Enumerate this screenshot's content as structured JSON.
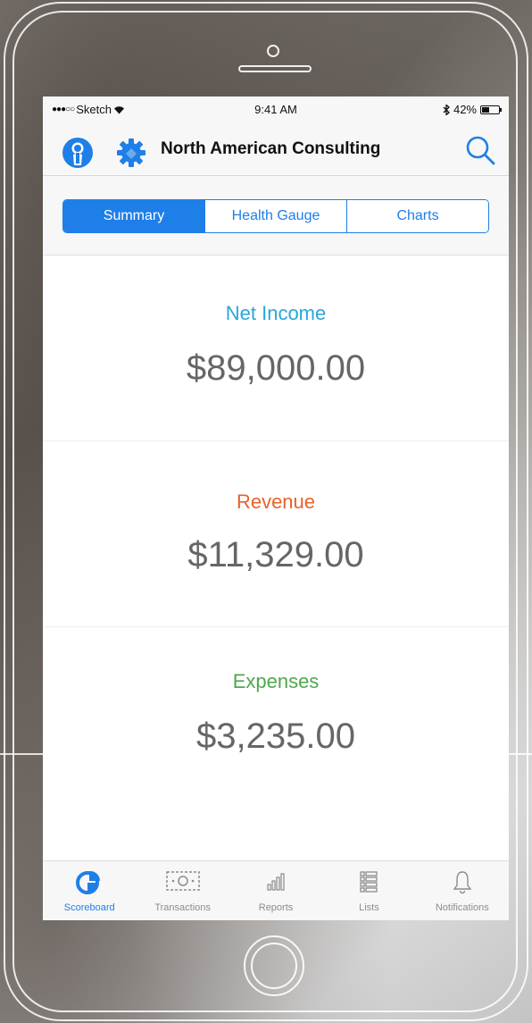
{
  "status_bar": {
    "carrier": "Sketch",
    "time": "9:41 AM",
    "battery": "42%"
  },
  "nav": {
    "title": "North American Consulting"
  },
  "segments": [
    {
      "label": "Summary",
      "active": true
    },
    {
      "label": "Health Gauge",
      "active": false
    },
    {
      "label": "Charts",
      "active": false
    }
  ],
  "cards": [
    {
      "label": "Net Income",
      "value": "$89,000.00",
      "color": "#2aa6d8"
    },
    {
      "label": "Revenue",
      "value": "$11,329.00",
      "color": "#e8632a"
    },
    {
      "label": "Expenses",
      "value": "$3,235.00",
      "color": "#4ea84e"
    }
  ],
  "tabs": [
    {
      "label": "Scoreboard",
      "icon": "pie-chart-icon",
      "active": true
    },
    {
      "label": "Transactions",
      "icon": "money-icon",
      "active": false
    },
    {
      "label": "Reports",
      "icon": "bar-chart-icon",
      "active": false
    },
    {
      "label": "Lists",
      "icon": "list-icon",
      "active": false
    },
    {
      "label": "Notifications",
      "icon": "bell-icon",
      "active": false
    }
  ],
  "colors": {
    "accent": "#1f7fe8"
  }
}
